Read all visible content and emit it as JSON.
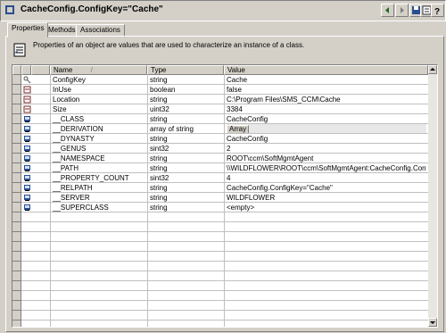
{
  "window": {
    "title": "CacheConfig.ConfigKey=\"Cache\""
  },
  "toolbar": {
    "buttons": [
      "back-icon",
      "forward-icon",
      "save-icon",
      "properties-icon",
      "help-icon"
    ]
  },
  "tabs": [
    {
      "label": "Properties",
      "active": true
    },
    {
      "label": "Methods",
      "active": false
    },
    {
      "label": "Associations",
      "active": false
    }
  ],
  "description": "Properties of an object are values that are used to characterize an instance of a class.",
  "grid": {
    "columns": [
      "Name",
      "Type",
      "Value"
    ],
    "rows": [
      {
        "name": "ConfigKey",
        "type": "string",
        "value": "Cache",
        "icon": "key-property-icon"
      },
      {
        "name": "InUse",
        "type": "boolean",
        "value": "false",
        "icon": "property-icon"
      },
      {
        "name": "Location",
        "type": "string",
        "value": "C:\\Program Files\\SMS_CCM\\Cache",
        "icon": "property-icon"
      },
      {
        "name": "Size",
        "type": "uint32",
        "value": "3384",
        "icon": "property-icon"
      },
      {
        "name": "__CLASS",
        "type": "string",
        "value": "CacheConfig",
        "icon": "system-property-icon"
      },
      {
        "name": "__DERIVATION",
        "type": "array of string",
        "value": "Array",
        "icon": "system-property-icon",
        "button": true
      },
      {
        "name": "__DYNASTY",
        "type": "string",
        "value": "CacheConfig",
        "icon": "system-property-icon"
      },
      {
        "name": "__GENUS",
        "type": "sint32",
        "value": "2",
        "icon": "system-property-icon"
      },
      {
        "name": "__NAMESPACE",
        "type": "string",
        "value": "ROOT\\ccm\\SoftMgmtAgent",
        "icon": "system-property-icon"
      },
      {
        "name": "__PATH",
        "type": "string",
        "value": "\\\\WILDFLOWER\\ROOT\\ccm\\SoftMgmtAgent:CacheConfig.ConfigKey=\"\\",
        "icon": "system-property-icon"
      },
      {
        "name": "__PROPERTY_COUNT",
        "type": "sint32",
        "value": "4",
        "icon": "system-property-icon"
      },
      {
        "name": "__RELPATH",
        "type": "string",
        "value": "CacheConfig.ConfigKey=\"Cache\"",
        "icon": "system-property-icon"
      },
      {
        "name": "__SERVER",
        "type": "string",
        "value": "WILDFLOWER",
        "icon": "system-property-icon"
      },
      {
        "name": "__SUPERCLASS",
        "type": "string",
        "value": "<empty>",
        "icon": "system-property-icon"
      }
    ]
  }
}
